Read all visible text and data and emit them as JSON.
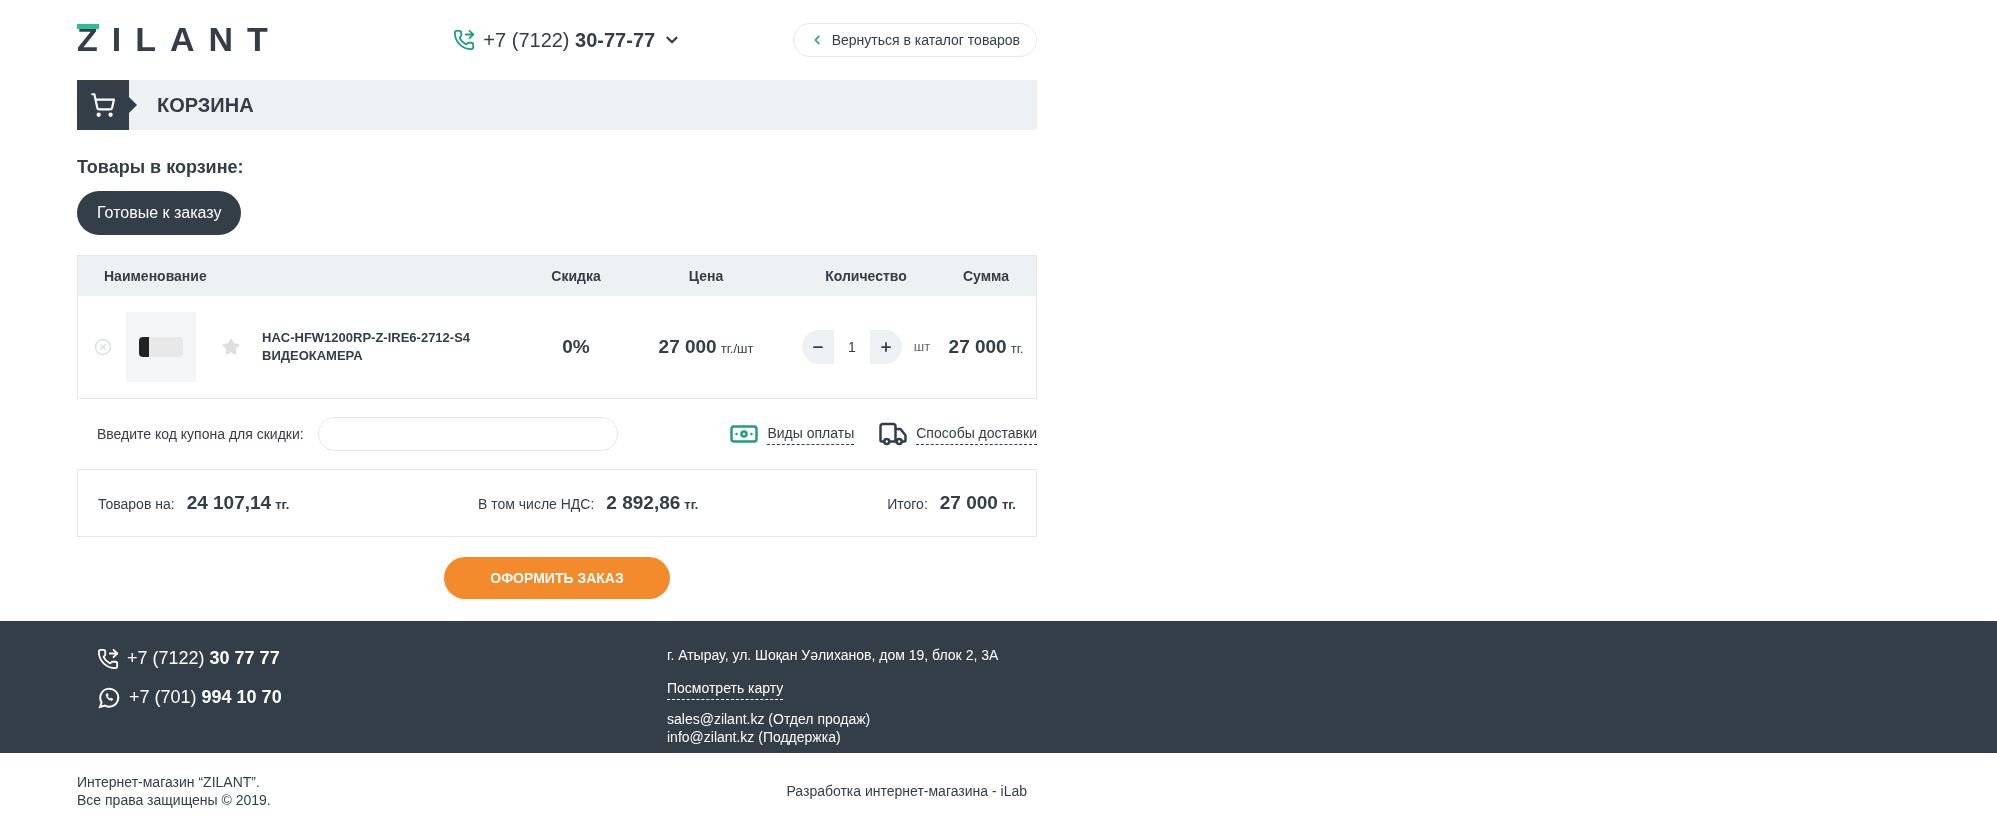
{
  "header": {
    "logo": "ZILANT",
    "phone_prefix": "+7 (7122)",
    "phone_number": "30-77-77",
    "back_link": "Вернуться в каталог товаров"
  },
  "page_title": "КОРЗИНА",
  "cart_heading": "Товары в корзине:",
  "cart_tabs": [
    {
      "label": "Готовые к заказу",
      "selected": true
    }
  ],
  "table": {
    "columns": [
      "Наименование",
      "Скидка",
      "Цена",
      "Количество",
      "Сумма"
    ],
    "rows": [
      {
        "sku": "HAC-HFW1200RP-Z-IRE6-2712-S4",
        "title": "ВИДЕОКАМЕРА",
        "favorite": false,
        "discount": "0%",
        "price": "27 000",
        "price_unit": "тг./шт",
        "quantity": "1",
        "quantity_unit": "шт",
        "sum": "27 000",
        "sum_unit": "тг."
      }
    ]
  },
  "coupon": {
    "label": "Введите код купона для скидки:"
  },
  "links": [
    {
      "kind": "payment",
      "label": "Виды оплаты"
    },
    {
      "kind": "delivery",
      "label": "Способы доставки"
    }
  ],
  "totals": [
    {
      "label": "Товаров на:",
      "value": "24 107,14",
      "unit": "тг."
    },
    {
      "label": "В том числе НДС:",
      "value": "2 892,86",
      "unit": "тг."
    },
    {
      "label": "Итого:",
      "value": "27 000",
      "unit": "тг."
    }
  ],
  "order_button": "ОФОРМИТЬ ЗАКАЗ",
  "footer": {
    "phones": [
      {
        "kind": "phone",
        "prefix": "+7 (7122)",
        "number": "30 77 77"
      },
      {
        "kind": "whatsapp",
        "prefix": "+7 (701)",
        "number": "994 10 70"
      }
    ],
    "address": "г. Атырау, ул. Шоқан Уәлиханов, дом 19, блок 2, 3А",
    "map_link": "Посмотреть карту",
    "emails": [
      "sales@zilant.kz (Отдел продаж)",
      "info@zilant.kz (Поддержка)"
    ]
  },
  "bottom": {
    "copyright": [
      "Интернет-магазин “ZILANT”.",
      "Все права защищены © 2019."
    ],
    "developer": "Разработка интернет-магазина - iLab"
  }
}
